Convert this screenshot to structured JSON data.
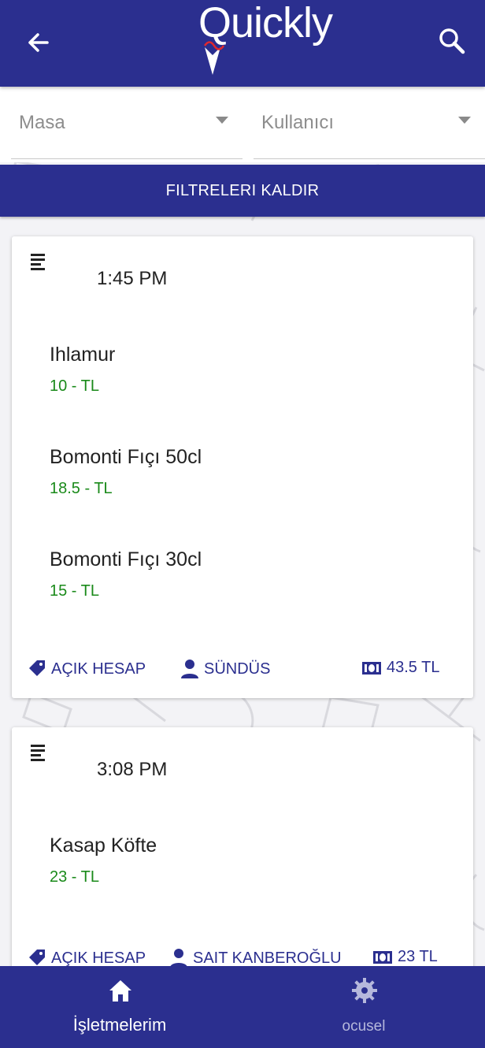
{
  "header": {
    "logo_text": "Quickly",
    "back_icon": "arrow-left-icon",
    "search_icon": "search-icon"
  },
  "filters": {
    "table_label": "Masa",
    "user_label": "Kullanıcı",
    "clear_button": "FILTRELERI KALDIR"
  },
  "orders": [
    {
      "time": "1:45 PM",
      "items": [
        {
          "name": "Ihlamur",
          "price": "10 - TL"
        },
        {
          "name": "Bomonti Fıçı 50cl",
          "price": "18.5 - TL"
        },
        {
          "name": "Bomonti Fıçı 30cl",
          "price": "15 - TL"
        }
      ],
      "status": "AÇIK HESAP",
      "user": "SÜNDÜS",
      "total": "43.5 TL"
    },
    {
      "time": "3:08 PM",
      "items": [
        {
          "name": "Kasap Köfte",
          "price": "23 - TL"
        }
      ],
      "status": "AÇIK HESAP",
      "user": "SAIT KANBEROĞLU",
      "total": "23 TL"
    }
  ],
  "bottom_nav": {
    "items": [
      {
        "label": "İşletmelerim",
        "icon": "home-icon",
        "active": true
      },
      {
        "label": "ocusel",
        "icon": "gear-icon",
        "active": false
      }
    ]
  },
  "colors": {
    "primary": "#2b2f8f",
    "price_green": "#1a8a1a",
    "accent_red": "#e0282e"
  }
}
